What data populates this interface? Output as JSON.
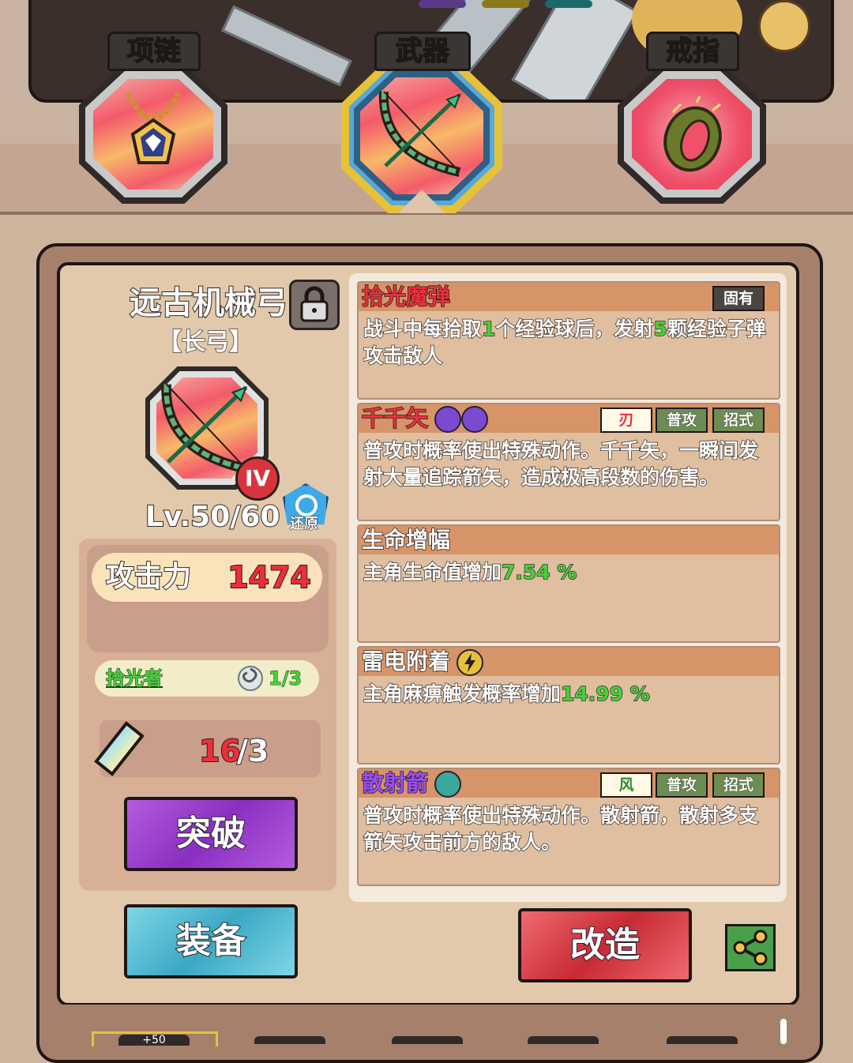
{
  "tabs": [
    {
      "label": "项链",
      "icon": "necklace-icon"
    },
    {
      "label": "武器",
      "icon": "bow-icon",
      "selected": true
    },
    {
      "label": "戒指",
      "icon": "ring-icon"
    }
  ],
  "item": {
    "name": "远古机械弓",
    "type": "【长弓】",
    "rank": "IV",
    "level": "Lv.50/60",
    "restore_label": "还原"
  },
  "stats": {
    "attack_label": "攻击力",
    "attack_value": "1474",
    "set_name": "拾光者",
    "set_progress": "1/3",
    "crystal_have": "16",
    "crystal_need": "/3"
  },
  "buttons": {
    "breakthrough": "突破",
    "equip": "装备",
    "reforge": "改造"
  },
  "skills": [
    {
      "name": "拾光魔弹",
      "name_color": "#e8303c",
      "tags": [
        "固有"
      ],
      "desc_parts": [
        "战斗中每拾取",
        "1",
        "个经验球后，发射",
        "5",
        "颗经验子弹攻击敌人"
      ]
    },
    {
      "name": "千千矢",
      "name_color": "#e8303c",
      "tags": [
        "刃",
        "普攻",
        "招式"
      ],
      "desc": "普攻时概率使出特殊动作。千千矢，一瞬间发射大量追踪箭矢，造成极高段数的伤害。"
    },
    {
      "name": "生命增幅",
      "name_color": "#ffffff",
      "tags": [],
      "desc_parts": [
        "主角生命值增加",
        "7.54 %"
      ]
    },
    {
      "name": "雷电附着",
      "name_color": "#ffffff",
      "tags": [],
      "desc_parts": [
        "主角麻痹触发概率增加",
        "14.99 %"
      ]
    },
    {
      "name": "散射箭",
      "name_color": "#9b4dff",
      "tags": [
        "风",
        "普攻",
        "招式"
      ],
      "desc": "普攻时概率使出特殊动作。散射箭，散射多支箭矢攻击前方的敌人。"
    }
  ],
  "bottom": {
    "first_slot_text": "+50"
  },
  "colors": {
    "highlight_green": "#46d13a",
    "red_value": "#e8303c",
    "purple_button": "#9b3fd0",
    "teal_button": "#4fb8d0",
    "red_button": "#d9343e"
  }
}
